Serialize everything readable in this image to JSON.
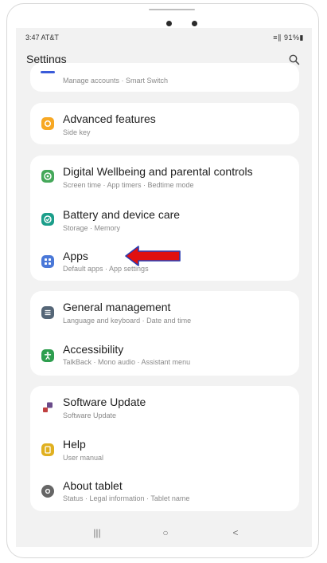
{
  "status_bar": {
    "time": "3:47 AT&T",
    "icons": "≡∥ 91%▮"
  },
  "header": {
    "title": "Settings"
  },
  "top_partial": {
    "subtitle": "Manage accounts · Smart Switch"
  },
  "groups": [
    {
      "items": [
        {
          "title": "Advanced features",
          "subtitle": "Side key",
          "icon": "advanced-features-icon",
          "color": "#f7a824"
        }
      ]
    },
    {
      "items": [
        {
          "title": "Digital Wellbeing and parental controls",
          "subtitle": "Screen time · App timers · Bedtime mode",
          "icon": "digital-wellbeing-icon",
          "color": "#45a85a"
        },
        {
          "title": "Battery and device care",
          "subtitle": "Storage · Memory",
          "icon": "device-care-icon",
          "color": "#1b9e8a"
        },
        {
          "title": "Apps",
          "subtitle": "Default apps · App settings",
          "icon": "apps-icon",
          "color": "#4a78d8"
        }
      ]
    },
    {
      "items": [
        {
          "title": "General management",
          "subtitle": "Language and keyboard · Date and time",
          "icon": "general-management-icon",
          "color": "#556677"
        },
        {
          "title": "Accessibility",
          "subtitle": "TalkBack · Mono audio · Assistant menu",
          "icon": "accessibility-icon",
          "color": "#2e9e4f"
        }
      ]
    },
    {
      "items": [
        {
          "title": "Software Update",
          "subtitle": "Software Update",
          "icon": "software-update-icon",
          "color": "#6a4b8a"
        },
        {
          "title": "Help",
          "subtitle": "User manual",
          "icon": "help-icon",
          "color": "#e0b020"
        },
        {
          "title": "About tablet",
          "subtitle": "Status · Legal information · Tablet name",
          "icon": "about-tablet-icon",
          "color": "#666666"
        }
      ]
    }
  ],
  "nav": {
    "recent": "|||",
    "home": "○",
    "back": "<"
  },
  "annotation": {
    "color": "#e01010",
    "outline": "#2a3bb0"
  }
}
